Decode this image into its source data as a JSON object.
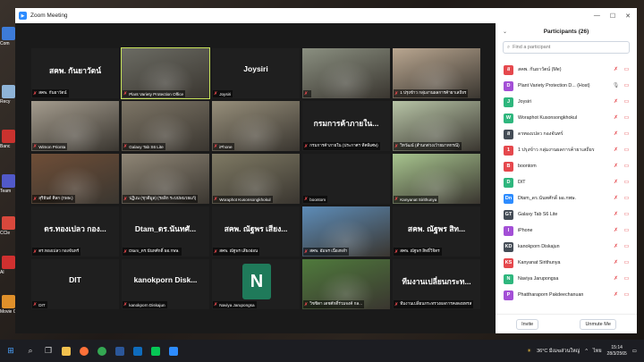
{
  "window": {
    "title": "Zoom Meeting",
    "icon": "zoom-logo-icon"
  },
  "panel": {
    "title": "Participants (26)",
    "search_placeholder": "Find a participant",
    "invite_label": "Invite",
    "unmute_me_label": "Unmute Me",
    "participants": [
      {
        "initial": "ส",
        "color": "#e5484d",
        "name": "สคพ. กันยาวัตน์ (Me)",
        "mic": "muted"
      },
      {
        "initial": "D",
        "color": "#a34fd6",
        "name": "Plant Variety Protection D... (Host)",
        "mic": "on"
      },
      {
        "initial": "J",
        "color": "#2eb67d",
        "name": "Joysiri",
        "mic": "muted"
      },
      {
        "initial": "W",
        "color": "#2eb67d",
        "name": "Woraphot Kusonsongkhokul",
        "mic": "muted"
      },
      {
        "initial": "ส",
        "color": "#444c56",
        "name": "ดรทองเปลว กองจันทร์",
        "mic": "muted"
      },
      {
        "initial": "1",
        "color": "#e5484d",
        "name": "1 ปรุงข้าว กลุ่มงานผลการค้ายาเสถียร",
        "mic": "muted"
      },
      {
        "initial": "B",
        "color": "#e5484d",
        "name": "boontom",
        "mic": "muted"
      },
      {
        "initial": "D",
        "color": "#2eb67d",
        "name": "DIT",
        "mic": "muted"
      },
      {
        "initial": "Dn",
        "color": "#2d8cff",
        "name": "Dtam_ดร.นันทศักดิ์ ผอ.กพษ.",
        "mic": "muted"
      },
      {
        "initial": "GT",
        "color": "#444c56",
        "name": "Galaxy Tab S6 Lite",
        "mic": "muted"
      },
      {
        "initial": "I",
        "color": "#a34fd6",
        "name": "iPhone",
        "mic": "muted"
      },
      {
        "initial": "KD",
        "color": "#444c56",
        "name": "kanokporn Diskajun",
        "mic": "muted"
      },
      {
        "initial": "KS",
        "color": "#e5484d",
        "name": "Kanyanat Sirithunya",
        "mic": "muted"
      },
      {
        "initial": "N",
        "color": "#2eb67d",
        "name": "Naviya Jarupongsa",
        "mic": "muted"
      },
      {
        "initial": "P",
        "color": "#a34fd6",
        "name": "Phattharaporn Pakdeechanuan",
        "mic": "muted"
      }
    ]
  },
  "tiles": [
    {
      "big": "สคพ. กันยาวัตน์",
      "name": "สคพ. กันยาวัตน์",
      "kind": "text"
    },
    {
      "big": "",
      "name": "Plant Variety Protection Office",
      "kind": "video",
      "bg": "#6b6b63",
      "active": true
    },
    {
      "big": "Joysiri",
      "name": "Joysiri",
      "kind": "text"
    },
    {
      "big": "",
      "name": "",
      "kind": "video",
      "bg": "#8a8f80"
    },
    {
      "big": "",
      "name": "1 ปรุงข้าว กลุ่มงานผลการค้ายาเสถียร",
      "kind": "video",
      "bg": "#b9a690"
    },
    {
      "big": "",
      "name": "Wimon Prionta",
      "kind": "video",
      "bg": "#a49c8e"
    },
    {
      "big": "",
      "name": "Galaxy Tab S6 Lite",
      "kind": "video",
      "bg": "#7d7566"
    },
    {
      "big": "",
      "name": "iPhone",
      "kind": "video",
      "bg": "#968e7a"
    },
    {
      "big": "กรมการค้าภายใน...",
      "name": "กรมการค้าภายใน (ประกาศฯ ทีคพิเศษ)",
      "kind": "text"
    },
    {
      "big": "",
      "name": "วิทวัฒน์ (สำนกต่วงเว้ายมาทกรณี)",
      "kind": "video",
      "bg": "#b7c4a6"
    },
    {
      "big": "",
      "name": "สุริยันต์ ศิลก (กพษ.)",
      "kind": "video",
      "bg": "#6f4e37"
    },
    {
      "big": "",
      "name": "ปฏิเณ (ชุวตีมูล) (รอลิก ระบปพนวยแก้)",
      "kind": "video",
      "bg": "#8f8676"
    },
    {
      "big": "",
      "name": "Woraphot Kusonsongkhokul",
      "kind": "video",
      "bg": "#7f7a64"
    },
    {
      "big": "",
      "name": "boontom",
      "kind": "blank"
    },
    {
      "big": "",
      "name": "Kanyanat Sirithunya",
      "kind": "video",
      "bg": "#a7c48e"
    },
    {
      "big": "ดร.ทองเปลว กอง...",
      "name": "ดร.ทองเปลว กองจันทร์",
      "kind": "text"
    },
    {
      "big": "Dtam_ดร.นันทศั...",
      "name": "Dtam_ดร.นันทศักดิ์ ผอ.กพษ.",
      "kind": "text"
    },
    {
      "big": "สคพ. ณัฐพร เสียง...",
      "name": "สคพ. ณัฐพร เสียงอ่อน",
      "kind": "text"
    },
    {
      "big": "",
      "name": "สคพ. อัมพร เนื่องหลำ",
      "kind": "photo",
      "bg": "#5d8cb8"
    },
    {
      "big": "สคพ. ณัฐพร สิท...",
      "name": "สคพ. ณัฐพร สิทธิ์วิจิตร",
      "kind": "text"
    },
    {
      "big": "DIT",
      "name": "DIT",
      "kind": "text"
    },
    {
      "big": "kanokporn Disk...",
      "name": "kanokporn Diskajun",
      "kind": "text"
    },
    {
      "big": "",
      "name": "Naviya Jarupongsa",
      "kind": "avatar",
      "initial": "N",
      "bg": "#1f7a5a"
    },
    {
      "big": "",
      "name": "วิชชิตา เดชศักดิ์ร่วมจงค์ กล...",
      "kind": "photo",
      "bg": "#4f7a3c"
    },
    {
      "big": "ทีมงานเปลี่ยนกระท...",
      "name": "ทีมงานเปลี่ยนกระทรวงผลการคงดงยทรส",
      "kind": "text"
    }
  ],
  "taskbar": {
    "weather": "36°C มีเมฆส่วนใหญ่",
    "language": "ไทย",
    "time": "15:14",
    "date": "28/3/2565"
  },
  "desktop_icons": [
    "Com",
    "Recy",
    "Banc",
    "Team",
    "CCle",
    "Al",
    "Movie Conve"
  ]
}
